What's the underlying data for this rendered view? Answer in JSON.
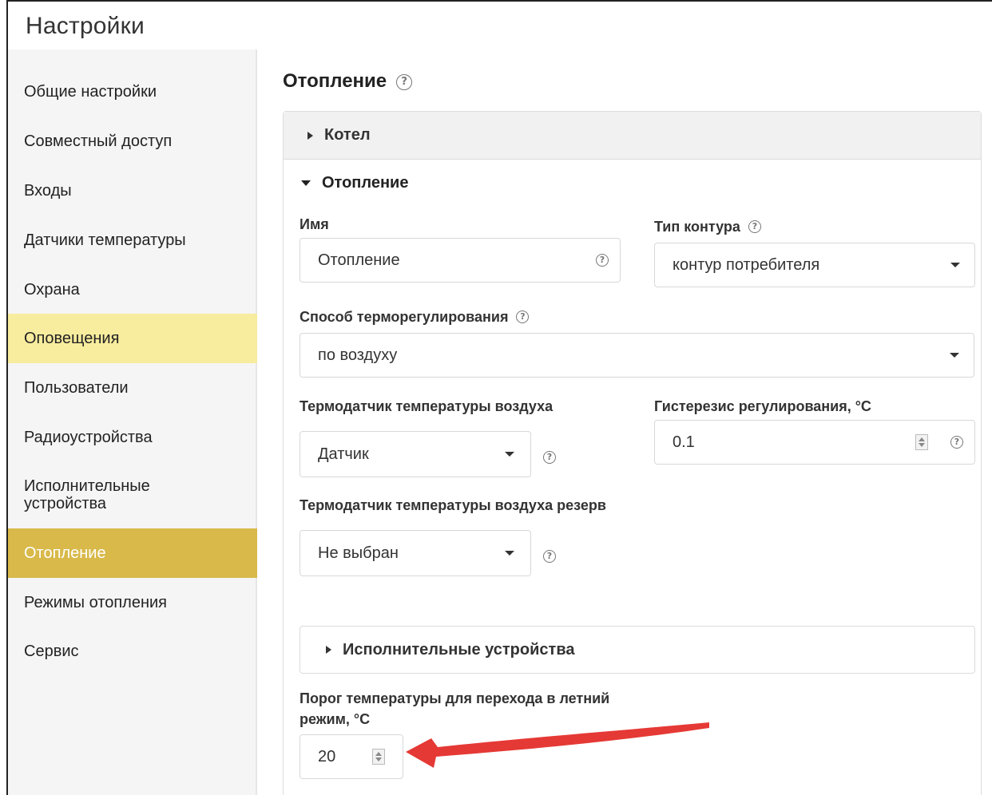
{
  "app": {
    "title": "Настройки"
  },
  "sidebar": {
    "items": [
      {
        "label": "Общие настройки"
      },
      {
        "label": "Совместный доступ"
      },
      {
        "label": "Входы"
      },
      {
        "label": "Датчики температуры"
      },
      {
        "label": "Охрана"
      },
      {
        "label": "Оповещения"
      },
      {
        "label": "Пользователи"
      },
      {
        "label": "Радиоустройства"
      },
      {
        "label": "Исполнительные устройства"
      },
      {
        "label": "Отопление"
      },
      {
        "label": "Режимы отопления"
      },
      {
        "label": "Сервис"
      }
    ],
    "highlighted_index": 5,
    "active_index": 9,
    "highlight_color": "#f8ec9e",
    "active_color": "#d8b94a"
  },
  "main": {
    "title": "Отопление",
    "help_glyph": "?",
    "boiler_section": {
      "label": "Котел"
    },
    "heating_section": {
      "label": "Отопление"
    },
    "form": {
      "name": {
        "label": "Имя",
        "value": "Отопление"
      },
      "circuit_type": {
        "label": "Тип контура",
        "value": "контур потребителя"
      },
      "regulation_method": {
        "label": "Способ терморегулирования",
        "value": "по воздуху"
      },
      "air_sensor": {
        "label": "Термодатчик температуры воздуха",
        "value": "Датчик"
      },
      "hysteresis": {
        "label": "Гистерезис регулирования, °С",
        "value": "0.1"
      },
      "air_sensor_reserve": {
        "label": "Термодатчик температуры воздуха резерв",
        "value": "Не выбран"
      },
      "actuators_section": {
        "label": "Исполнительные устройства"
      },
      "summer_threshold": {
        "label_line1": "Порог температуры для перехода в летний",
        "label_line2": "режим, °С",
        "value": "20"
      }
    }
  },
  "annotation": {
    "color": "#e53935"
  }
}
